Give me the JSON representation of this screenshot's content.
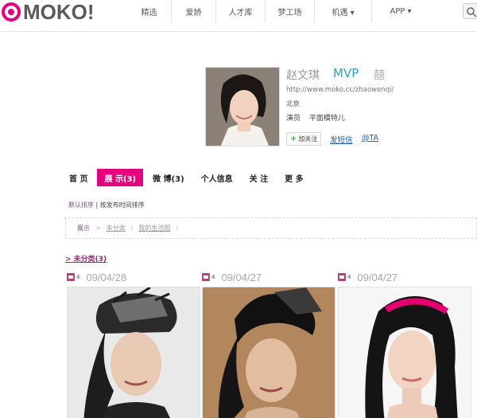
{
  "header": {
    "logo": "MOKO!",
    "nav": [
      "精选",
      "爱娇",
      "人才库",
      "梦工场",
      "机遇 ▾",
      "APP ▾"
    ]
  },
  "profile": {
    "name": "赵文琪",
    "badge": "MVP",
    "vip_mark": "囍",
    "url": "http://www.moko.cc/zhaowenqi/",
    "city": "北京",
    "tags": [
      "演员",
      "平面模特儿"
    ],
    "follow_label": "加关注",
    "message_label": "发短信",
    "mention_label": "@TA"
  },
  "tabs": [
    {
      "label": "首 页",
      "active": false
    },
    {
      "label": "展 示(3)",
      "active": true
    },
    {
      "label": "微 博(3)",
      "active": false
    },
    {
      "label": "个人信息",
      "active": false
    },
    {
      "label": "关 注",
      "active": false
    },
    {
      "label": "更 多",
      "active": false
    }
  ],
  "sort": {
    "default": "默认排序",
    "separator": " | ",
    "by_time": "按发布时间排序"
  },
  "breadcrumb": [
    "展示",
    "未分类",
    "我的生活照",
    "/"
  ],
  "folder": {
    "label": "> 未分类(3)"
  },
  "cards": [
    {
      "count": "4",
      "date": "09/04/28"
    },
    {
      "count": "4",
      "date": "09/04/27"
    },
    {
      "count": "4",
      "date": "09/04/27"
    }
  ],
  "colors": {
    "accent": "#e4007f",
    "mvp": "#2ba1c4",
    "link": "#1f5fa8",
    "folder": "#8a2f78"
  }
}
